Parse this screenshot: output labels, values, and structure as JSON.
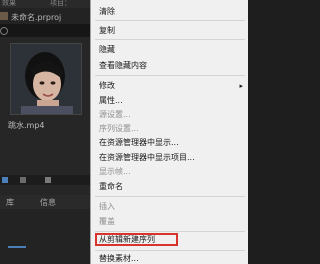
{
  "tabs": {
    "effects": "效果",
    "project": "项目："
  },
  "project": {
    "name": "未命名.prproj"
  },
  "clip": {
    "name": "跳水.mp4"
  },
  "lower_tabs": {
    "library": "库",
    "info": "信息"
  },
  "menu": {
    "items": [
      "清除",
      "复制",
      "隐藏",
      "查看隐藏内容",
      "修改",
      "属性...",
      "源设置...",
      "序列设置...",
      "在资源管理器中显示...",
      "在资源管理器中显示项目...",
      "显示帧...",
      "重命名",
      "插入",
      "覆盖",
      "从剪辑新建序列",
      "替换素材..."
    ],
    "submenu_arrow": "▸"
  },
  "colors": {
    "highlight_box": "#d9342b",
    "menu_bg": "#f0f0f0",
    "panel_bg": "#262626",
    "accent": "#4a7fb8"
  }
}
